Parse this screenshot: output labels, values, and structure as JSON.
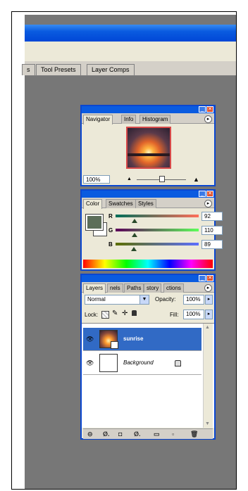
{
  "workspace": {
    "tabs": [
      "s",
      "Tool Presets",
      "Layer Comps"
    ]
  },
  "navigator": {
    "tabs": [
      "Navigator",
      "Info",
      "Histogram"
    ],
    "zoom_value": "100%"
  },
  "color_panel": {
    "tabs": [
      "Color",
      "Swatches",
      "Styles"
    ],
    "r_label": "R",
    "g_label": "G",
    "b_label": "B",
    "r_value": "92",
    "g_value": "110",
    "b_value": "89",
    "foreground_hex": "#5c6e59"
  },
  "layers_panel": {
    "tabs": [
      "Layers",
      "nels",
      "Paths",
      "story",
      "ctions"
    ],
    "blend_mode": "Normal",
    "opacity_label": "Opacity:",
    "opacity_value": "100%",
    "lock_label": "Lock:",
    "fill_label": "Fill:",
    "fill_value": "100%",
    "layers": [
      {
        "name": "sunrise",
        "selected": true
      },
      {
        "name": "Background",
        "selected": false
      }
    ]
  },
  "colors": {
    "title_blue": "#0a5be0",
    "panel_bg": "#ece9d8",
    "workspace_gray": "#777777",
    "selected_row": "#316ac5"
  }
}
